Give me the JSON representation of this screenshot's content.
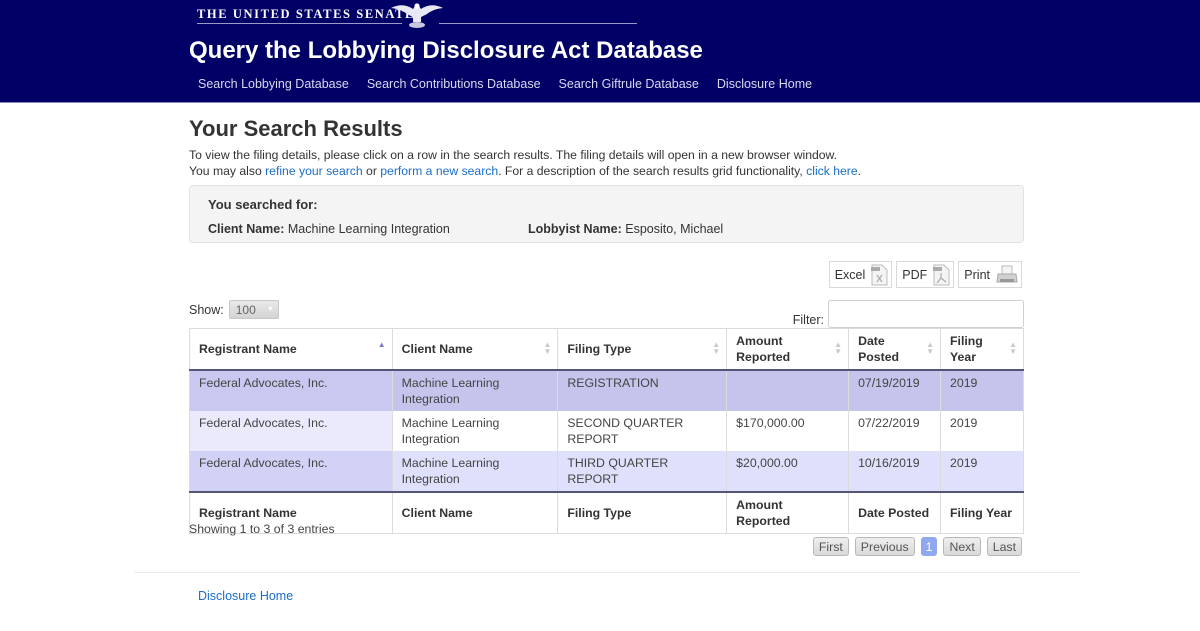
{
  "header": {
    "senate_label": "THE UNITED STATES SENATE",
    "site_title": "Query the Lobbying Disclosure Act Database",
    "nav": [
      {
        "label": "Search Lobbying Database"
      },
      {
        "label": "Search Contributions Database"
      },
      {
        "label": "Search Giftrule Database"
      },
      {
        "label": "Disclosure Home"
      }
    ]
  },
  "main": {
    "title": "Your Search Results",
    "intro_line1": "To view the filing details, please click on a row in the search results. The filing details will open in a new browser window.",
    "intro_line2_a": "You may also ",
    "link_refine": "refine your search",
    "intro_line2_b": " or ",
    "link_new": "perform a new search",
    "intro_line2_c": ". For a description of the search results grid functionality, ",
    "link_click_here": "click here",
    "intro_line2_d": "."
  },
  "search_summary": {
    "title": "You searched for:",
    "client_label": "Client Name:",
    "client_value": " Machine Learning Integration",
    "lobbyist_label": "Lobbyist Name:",
    "lobbyist_value": " Esposito, Michael"
  },
  "export": {
    "excel": "Excel",
    "pdf": "PDF",
    "print": "Print"
  },
  "controls": {
    "show_label": "Show:",
    "show_value": "100",
    "filter_label": "Filter:",
    "filter_value": ""
  },
  "table": {
    "columns": [
      "Registrant Name",
      "Client Name",
      "Filing Type",
      "Amount Reported",
      "Date Posted",
      "Filing Year"
    ],
    "sorted_column": "Registrant Name",
    "sort_direction": "ascending",
    "rows": [
      {
        "registrant": "Federal Advocates, Inc.",
        "client": "Machine Learning Integration",
        "filing_type": "REGISTRATION",
        "amount": "",
        "date_posted": "07/19/2019",
        "year": "2019"
      },
      {
        "registrant": "Federal Advocates, Inc.",
        "client": "Machine Learning Integration",
        "filing_type": "SECOND QUARTER REPORT",
        "amount": "$170,000.00",
        "date_posted": "07/22/2019",
        "year": "2019"
      },
      {
        "registrant": "Federal Advocates, Inc.",
        "client": "Machine Learning Integration",
        "filing_type": "THIRD QUARTER REPORT",
        "amount": "$20,000.00",
        "date_posted": "10/16/2019",
        "year": "2019"
      }
    ]
  },
  "pagination": {
    "info": "Showing 1 to 3 of 3 entries",
    "first": "First",
    "previous": "Previous",
    "current": "1",
    "next": "Next",
    "last": "Last"
  },
  "footer": {
    "link": "Disclosure Home"
  }
}
